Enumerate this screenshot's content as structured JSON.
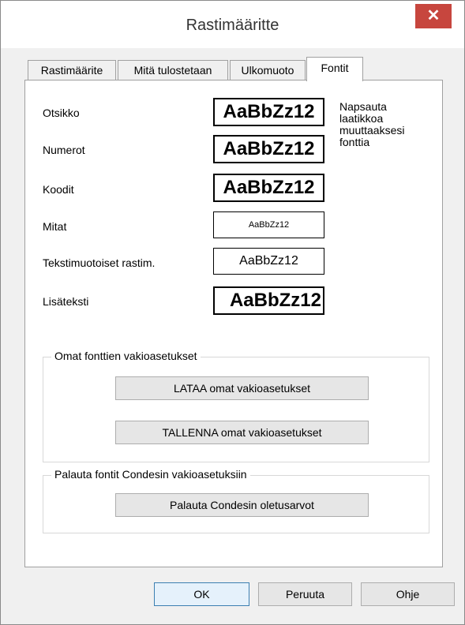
{
  "window": {
    "title": "Rastimääritte",
    "close_glyph": "✕"
  },
  "tabs": [
    {
      "label": "Rastimäärite",
      "active": false
    },
    {
      "label": "Mitä tulostetaan",
      "active": false
    },
    {
      "label": "Ulkomuoto",
      "active": false
    },
    {
      "label": "Fontit",
      "active": true
    }
  ],
  "fonts": [
    {
      "label": "Otsikko",
      "sample": "AaBbZz12"
    },
    {
      "label": "Numerot",
      "sample": "AaBbZz12"
    },
    {
      "label": "Koodit",
      "sample": "AaBbZz12"
    },
    {
      "label": "Mitat",
      "sample": "AaBbZz12"
    },
    {
      "label": "Tekstimuotoiset rastim.",
      "sample": "AaBbZz12"
    },
    {
      "label": "Lisäteksti",
      "sample": "AaBbZz12"
    }
  ],
  "hint": "Napsauta laatikkoa muuttaaksesi fonttia",
  "own_defaults": {
    "legend": "Omat fonttien vakioasetukset",
    "load_label": "LATAA omat vakioasetukset",
    "save_label": "TALLENNA omat vakioasetukset"
  },
  "restore": {
    "legend": "Palauta fontit Condesin vakioasetuksiin",
    "button_label": "Palauta Condesin oletusarvot"
  },
  "footer": {
    "ok_label": "OK",
    "cancel_label": "Peruuta",
    "help_label": "Ohje"
  },
  "colors": {
    "close_button": "#c7463e",
    "dialog_bg": "#f0f0f0",
    "default_button_border": "#3c7fb1"
  }
}
